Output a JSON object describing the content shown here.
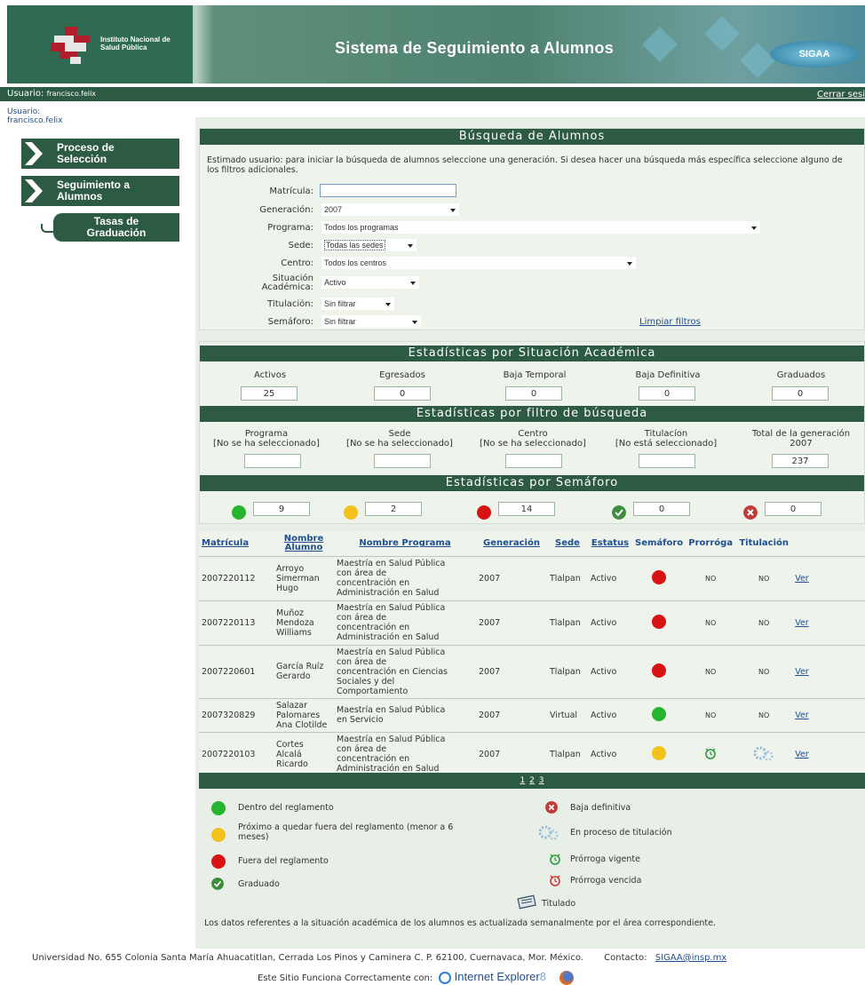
{
  "banner": {
    "institution_line1": "Instituto Nacional de",
    "institution_line2": "Salud Pública",
    "system_title": "Sistema de Seguimiento a Alumnos",
    "badge": "SIGAA"
  },
  "userbar": {
    "label": "Usuario:",
    "username": "francisco.felix",
    "logout": "Cerrar sesi"
  },
  "sidebar": {
    "user_label": "Usuario:",
    "username": "francisco.felix",
    "items": [
      {
        "line1": "Proceso de",
        "line2": "Selección"
      },
      {
        "line1": "Seguimiento a",
        "line2": "Alumnos"
      },
      {
        "line1": "Tasas de",
        "line2": "Graduación"
      }
    ]
  },
  "search": {
    "title": "Búsqueda de Alumnos",
    "intro": "Estimado usuario: para iniciar la búsqueda de alumnos seleccione una generación. Si desea hacer una búsqueda más específica seleccione alguno de los filtros adicionales.",
    "fields": {
      "matricula_label": "Matrícula:",
      "matricula_value": "",
      "generacion_label": "Generación:",
      "generacion_value": "2007",
      "programa_label": "Programa:",
      "programa_value": "Todos los programas",
      "sede_label": "Sede:",
      "sede_value": "Todas las sedes",
      "centro_label": "Centro:",
      "centro_value": "Todos los centros",
      "situacion_label_1": "Situación",
      "situacion_label_2": "Académica:",
      "situacion_value": "Activo",
      "titulacion_label": "Titulación:",
      "titulacion_value": "Sin filtrar",
      "semaforo_label": "Semáforo:",
      "semaforo_value": "Sin filtrar"
    },
    "clear_filters": "Limpiar filtros"
  },
  "stats_situacion": {
    "title": "Estadísticas por Situación Académica",
    "items": [
      {
        "label": "Activos",
        "value": "25"
      },
      {
        "label": "Egresados",
        "value": "0"
      },
      {
        "label": "Baja Temporal",
        "value": "0"
      },
      {
        "label": "Baja Definitiva",
        "value": "0"
      },
      {
        "label": "Graduados",
        "value": "0"
      }
    ]
  },
  "stats_filtro": {
    "title": "Estadísticas por filtro de búsqueda",
    "items": [
      {
        "label": "Programa",
        "sub": "[No se ha seleccionado]",
        "value": ""
      },
      {
        "label": "Sede",
        "sub": "[No se ha seleccionado]",
        "value": ""
      },
      {
        "label": "Centro",
        "sub": "[No se ha seleccionado]",
        "value": ""
      },
      {
        "label": "Titulacíon",
        "sub": "[No está seleccionado]",
        "value": ""
      },
      {
        "label": "Total de la generación",
        "sub": "2007",
        "value": "237"
      }
    ]
  },
  "stats_semaforo": {
    "title": "Estadísticas por Semáforo",
    "values": [
      "9",
      "2",
      "14",
      "0",
      "0"
    ]
  },
  "colors": {
    "green": "#27b52f",
    "yellow": "#f2c21b",
    "red": "#d81313",
    "dark_green": "#2d5a42"
  },
  "table": {
    "headers": {
      "matricula": "Matrícula",
      "nombre_1": "Nombre",
      "nombre_2": "Alumno",
      "programa": "Nombre Programa",
      "generacion": "Generación",
      "sede": "Sede",
      "estatus": "Estatus",
      "semaforo": "Semáforo",
      "prorroga": "Prorróga",
      "titulacion": "Titulación"
    },
    "rows": [
      {
        "matricula": "2007220112",
        "nombre": [
          "Arroyo",
          "Simerman",
          "Hugo"
        ],
        "programa": [
          "Maestría en Salud Pública",
          "con área de",
          "concentración en",
          "Administración en Salud"
        ],
        "generacion": "2007",
        "sede": "Tlalpan",
        "estatus": "Activo",
        "semaforo": "red",
        "prorroga": "NO",
        "titulacion": "NO",
        "ver": "Ver"
      },
      {
        "matricula": "2007220113",
        "nombre": [
          "Muñoz",
          "Mendoza",
          "Williams"
        ],
        "programa": [
          "Maestría en Salud Pública",
          "con área de",
          "concentración en",
          "Administración en Salud"
        ],
        "generacion": "2007",
        "sede": "Tlalpan",
        "estatus": "Activo",
        "semaforo": "red",
        "prorroga": "NO",
        "titulacion": "NO",
        "ver": "Ver"
      },
      {
        "matricula": "2007220601",
        "nombre": [
          "García Ruíz",
          "Gerardo"
        ],
        "programa": [
          "Maestría en Salud Pública",
          "con área de",
          "concentración en Ciencias",
          "Sociales y del",
          "Comportamiento"
        ],
        "generacion": "2007",
        "sede": "Tlalpan",
        "estatus": "Activo",
        "semaforo": "red",
        "prorroga": "NO",
        "titulacion": "NO",
        "ver": "Ver"
      },
      {
        "matricula": "2007320829",
        "nombre": [
          "Salazar",
          "Palomares",
          "Ana Clotilde"
        ],
        "programa": [
          "Maestría en Salud Pública",
          "en Servicio"
        ],
        "generacion": "2007",
        "sede": "Virtual",
        "estatus": "Activo",
        "semaforo": "green",
        "prorroga": "NO",
        "titulacion": "NO",
        "ver": "Ver"
      },
      {
        "matricula": "2007220103",
        "nombre": [
          "Cortes Alcalá",
          "Ricardo"
        ],
        "programa": [
          "Maestría en Salud Pública",
          "con área de",
          "concentración en",
          "Administración en Salud"
        ],
        "generacion": "2007",
        "sede": "Tlalpan",
        "estatus": "Activo",
        "semaforo": "yellow",
        "prorroga": "",
        "titulacion": "",
        "ver": "Ver"
      }
    ],
    "pages": [
      "1",
      "2",
      "3"
    ]
  },
  "legend": {
    "dentro": "Dentro del reglamento",
    "proximo_1": "Próximo a quedar fuera del reglamento (menor a 6",
    "proximo_2": "meses)",
    "fuera": "Fuera del reglamento",
    "graduado": "Graduado",
    "baja": "Baja definitiva",
    "proceso": "En proceso de titulación",
    "vigente": "Prórroga vigente",
    "vencida": "Prórroga vencida",
    "titulado": "Titulado",
    "note": "Los datos referentes a la situación académica de los alumnos es actualizada semanalmente por el área correspondiente."
  },
  "footer": {
    "address": "Universidad No. 655 Colonia Santa María Ahuacatitlan, Cerrada Los Pinos y Caminera C. P. 62100, Cuernavaca, Mor. México.",
    "contact_label": "Contacto:",
    "contact_email": "SIGAA@insp.mx",
    "browser_note": "Este Sitio Funciona Correctamente con:",
    "browser_name": "Internet Explorer",
    "browser_version": "8"
  }
}
